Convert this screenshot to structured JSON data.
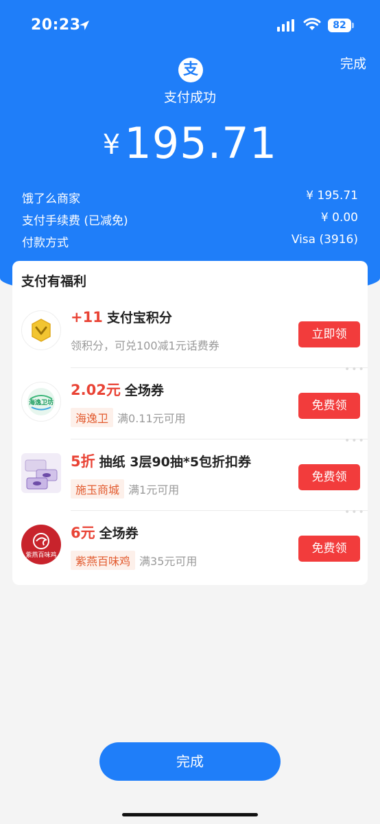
{
  "status_bar": {
    "time": "20:23",
    "battery": "82"
  },
  "header": {
    "done_label": "完成",
    "logo_char": "支",
    "success_text": "支付成功",
    "currency": "¥",
    "amount": "195.71"
  },
  "details": [
    {
      "label": "饿了么商家",
      "value": "¥ 195.71"
    },
    {
      "label": "支付手续费 (已减免)",
      "value": "¥ 0.00"
    },
    {
      "label": "付款方式",
      "value": "Visa (3916)"
    }
  ],
  "benefits": {
    "title": "支付有福利",
    "items": [
      {
        "highlight": "+11",
        "title": "支付宝积分",
        "tag": "",
        "desc": "领积分，可兑100减1元话费券",
        "button": "立即领",
        "logo": "points-coin-icon"
      },
      {
        "highlight": "2.02元",
        "title": "全场券",
        "tag": "海逸卫",
        "desc": "满0.11元可用",
        "button": "免费领",
        "logo": "haiyiwei-logo"
      },
      {
        "highlight": "5折",
        "title": "抽纸 3层90抽*5包折扣券",
        "tag": "施玉商城",
        "desc": "满1元可用",
        "button": "免费领",
        "logo": "tissue-product-image"
      },
      {
        "highlight": "6元",
        "title": "全场券",
        "tag": "紫燕百味鸡",
        "desc": "满35元可用",
        "button": "免费领",
        "logo": "ziyan-logo"
      }
    ],
    "logo_texts": {
      "haiyiwei": "海逸卫坊",
      "ziyan": "紫燕百味鸡"
    }
  },
  "footer": {
    "done_label": "完成"
  },
  "colors": {
    "primary": "#1f7ef9",
    "accent_red": "#f23c3c",
    "highlight_red": "#e94335"
  }
}
